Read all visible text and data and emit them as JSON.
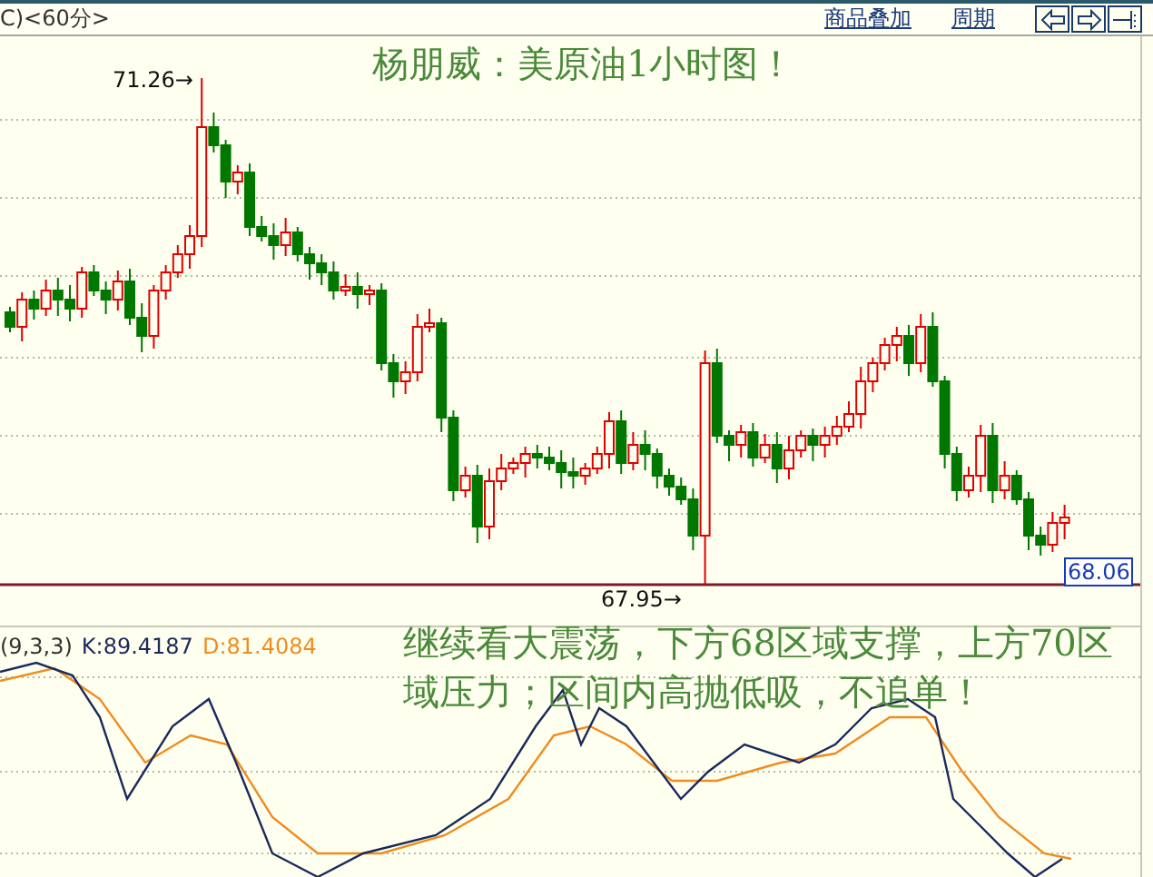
{
  "toolbar": {
    "chart_label": "C)<60分>",
    "links": [
      "商品叠加",
      "周期"
    ]
  },
  "chart": {
    "title": "杨朋威：美原油1小时图！",
    "high_label": "71.26→",
    "low_label": "67.95→",
    "last_price": "68.06"
  },
  "indicator": {
    "name": "(9,3,3)",
    "k": "K:89.4187",
    "d": "D:81.4084",
    "comment": "继续看大震荡，下方68区域支撑，上方70区域压力；区间内高抛低吸，不追单！"
  }
}
